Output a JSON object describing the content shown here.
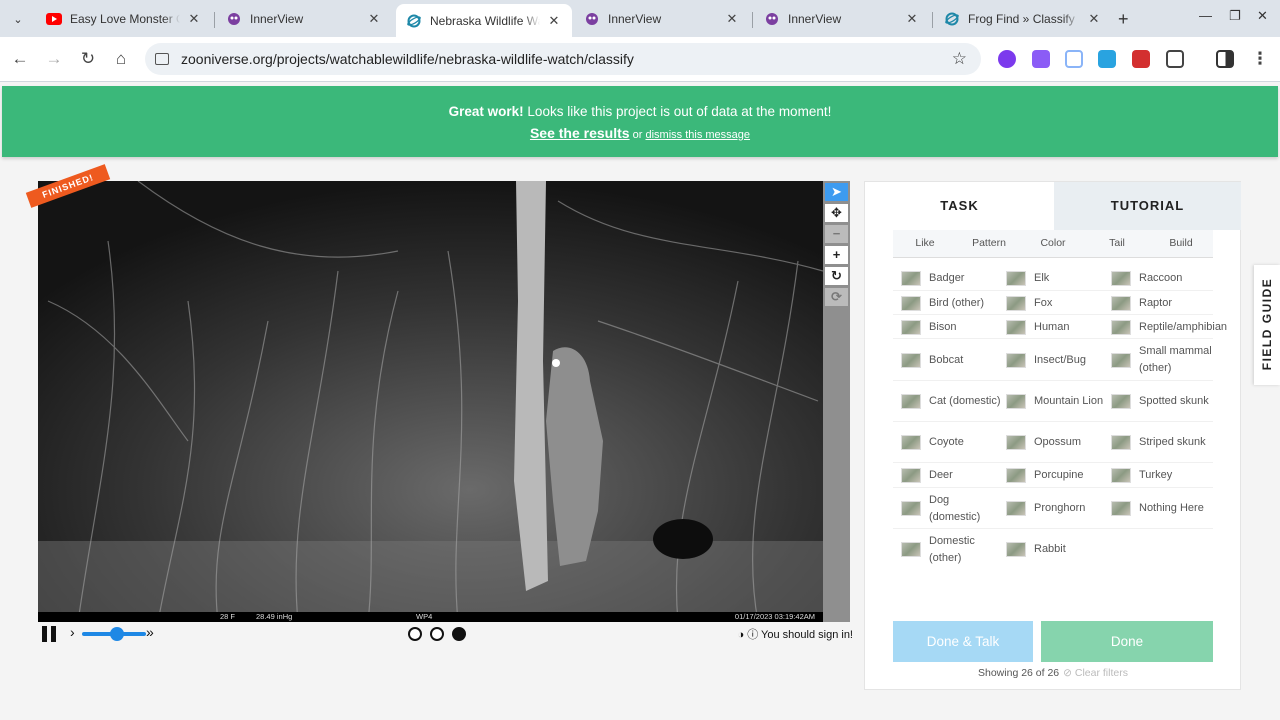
{
  "browser": {
    "tabs": [
      {
        "title": "Easy Love Monster Ca",
        "favicon": "youtube-icon",
        "active": false
      },
      {
        "title": "InnerView",
        "favicon": "innerview-icon",
        "active": false
      },
      {
        "title": "Nebraska Wildlife Wat",
        "favicon": "zooniverse-icon",
        "active": true
      },
      {
        "title": "InnerView",
        "favicon": "innerview-icon",
        "active": false
      },
      {
        "title": "InnerView",
        "favicon": "innerview-icon",
        "active": false
      },
      {
        "title": "Frog Find » Classify",
        "favicon": "zooniverse-icon",
        "active": false
      }
    ],
    "url": "zooniverse.org/projects/watchablewildlife/nebraska-wildlife-watch/classify"
  },
  "banner": {
    "strong": "Great work!",
    "message": " Looks like this project is out of data at the moment!",
    "results_link": "See the results",
    "or": " or ",
    "dismiss_link": "dismiss this message"
  },
  "viewer": {
    "badge": "FINISHED!",
    "camera_footer": {
      "temp": "28 F",
      "pressure": "28.49 inHg",
      "camera": "WP4",
      "datetime": "01/17/2023 03:19:42AM"
    },
    "frames": 3,
    "current_frame": 3,
    "signin_text": "You should sign in!"
  },
  "task_panel": {
    "tabs": [
      "TASK",
      "TUTORIAL"
    ],
    "filters": [
      "Like",
      "Pattern",
      "Color",
      "Tail",
      "Build"
    ],
    "choices": [
      [
        "Badger",
        "Elk",
        "Raccoon"
      ],
      [
        "Bird (other)",
        "Fox",
        "Raptor"
      ],
      [
        "Bison",
        "Human",
        "Reptile/amphibian"
      ],
      [
        "Bobcat",
        "Insect/Bug",
        "Small mammal (other)"
      ],
      [
        "Cat (domestic)",
        "Mountain Lion",
        "Spotted skunk"
      ],
      [
        "Coyote",
        "Opossum",
        "Striped skunk"
      ],
      [
        "Deer",
        "Porcupine",
        "Turkey"
      ],
      [
        "Dog (domestic)",
        "Pronghorn",
        "Nothing Here"
      ],
      [
        "Domestic (other)",
        "Rabbit",
        ""
      ]
    ],
    "showing": "Showing 26 of 26",
    "clear_filters": "Clear filters",
    "done_talk": "Done & Talk",
    "done": "Done"
  },
  "field_guide": "FIELD GUIDE",
  "colors": {
    "banner": "#3bb87a",
    "badge": "#ee5a1f",
    "done": "#86d4ad",
    "done_talk": "#a6d9f5"
  }
}
